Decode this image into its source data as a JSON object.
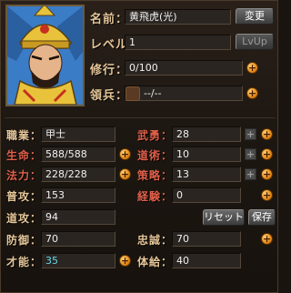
{
  "profile": {
    "name_label": "名前：",
    "name_value": "黄飛虎(光)",
    "rename_button": "変更",
    "level_label": "レベル：",
    "level_value": "1",
    "levelup_button": "LvUp",
    "training_label": "修行：",
    "training_value": "0/100",
    "troops_label": "領兵：",
    "troops_value": "--/--"
  },
  "stats_left": [
    {
      "label": "職業：",
      "value": "甲士"
    },
    {
      "label": "生命：",
      "value": "588/588"
    },
    {
      "label": "法力：",
      "value": "228/228"
    },
    {
      "label": "普攻：",
      "value": "153"
    },
    {
      "label": "道攻：",
      "value": "94"
    },
    {
      "label": "防御：",
      "value": "70"
    },
    {
      "label": "才能：",
      "value": "35"
    }
  ],
  "stats_right": [
    {
      "label": "武勇：",
      "value": "28"
    },
    {
      "label": "道術：",
      "value": "10"
    },
    {
      "label": "策略：",
      "value": "13"
    },
    {
      "label": "経験：",
      "value": "0"
    },
    {
      "label": "忠誠：",
      "value": "70"
    },
    {
      "label": "体給：",
      "value": "40"
    }
  ],
  "actions": {
    "reset_button": "リセット",
    "save_button": "保存"
  },
  "icons": {
    "plus": "+"
  },
  "colors": {
    "label_gold": "#e6c79a",
    "label_red": "#e0604a",
    "talent_cyan": "#66d9e8",
    "plus_orange": "#e38a18"
  }
}
